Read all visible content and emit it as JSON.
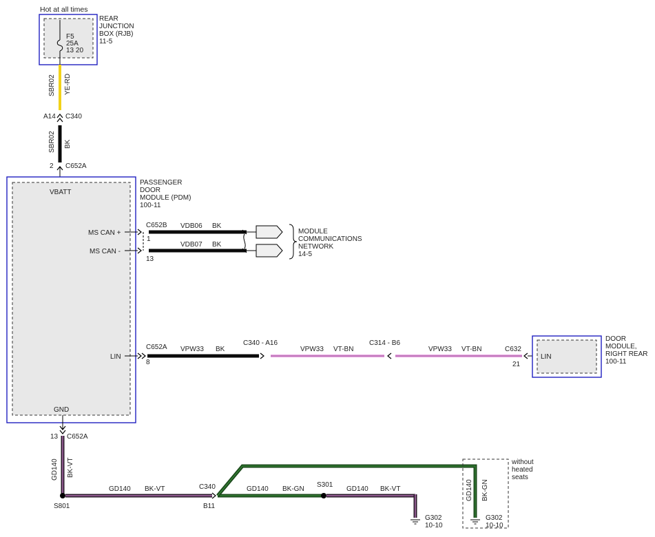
{
  "colors": {
    "module_border": "#2020c0",
    "module_fill": "#e8e8e8",
    "wire_black": "#0a0a0a",
    "wire_yellow": "#f2d21a",
    "wire_pink": "#e8a0e0",
    "wire_green": "#1c4a1c",
    "wire_violet": "#9a5c9a"
  },
  "rjb": {
    "header": "Hot at all times",
    "title_line1": "REAR",
    "title_line2": "JUNCTION",
    "title_line3": "BOX (RJB)",
    "ref": "11-5",
    "fuse_name": "F5",
    "fuse_rating": "25A",
    "fuse_pins": "13 20"
  },
  "wire_sbr02_upper": {
    "circuit": "SBR02",
    "color": "YE-RD"
  },
  "conn_c340_top": {
    "pin": "A14",
    "name": "C340"
  },
  "wire_sbr02_lower": {
    "circuit": "SBR02",
    "color": "BK"
  },
  "conn_c652a_top": {
    "pin": "2",
    "name": "C652A"
  },
  "pdm": {
    "title_line1": "PASSENGER",
    "title_line2": "DOOR",
    "title_line3": "MODULE (PDM)",
    "ref": "100-11",
    "vbatt": "VBATT",
    "ms_can_plus": "MS CAN +",
    "ms_can_minus": "MS CAN -",
    "lin": "LIN",
    "gnd": "GND"
  },
  "can": {
    "connector": "C652B",
    "pin_plus": "1",
    "pin_minus": "13",
    "plus_circuit": "VDB06",
    "plus_color": "BK",
    "minus_circuit": "VDB07",
    "minus_color": "BK",
    "net_line1": "MODULE",
    "net_line2": "COMMUNICATIONS",
    "net_line3": "NETWORK",
    "net_ref": "14-5"
  },
  "lin_run": {
    "c652a": "C652A",
    "c652a_pin": "8",
    "seg1_circuit": "VPW33",
    "seg1_color": "BK",
    "c340": "C340 - A16",
    "seg2_circuit": "VPW33",
    "seg2_color": "VT-BN",
    "c314": "C314 - B6",
    "seg3_circuit": "VPW33",
    "seg3_color": "VT-BN",
    "c632": "C632",
    "c632_pin": "21"
  },
  "door_module_rr": {
    "title_line1": "DOOR",
    "title_line2": "MODULE,",
    "title_line3": "RIGHT REAR",
    "ref": "100-11",
    "lin": "LIN"
  },
  "ground": {
    "gnd_pin": "13",
    "gnd_conn": "C652A",
    "vert_circuit": "GD140",
    "vert_color": "BK-VT",
    "splice_s801": "S801",
    "seg1_circuit": "GD140",
    "seg1_color": "BK-VT",
    "c340": "C340",
    "c340_pin": "B11",
    "seg2_circuit": "GD140",
    "seg2_color": "BK-GN",
    "splice_s301": "S301",
    "seg3_circuit": "GD140",
    "seg3_color": "BK-VT",
    "g302_a": "G302",
    "g302_a_ref": "10-10",
    "opt_line1": "without",
    "opt_line2": "heated",
    "opt_line3": "seats",
    "opt_circuit": "GD140",
    "opt_color": "BK-GN",
    "g302_b": "G302",
    "g302_b_ref": "10-10"
  }
}
